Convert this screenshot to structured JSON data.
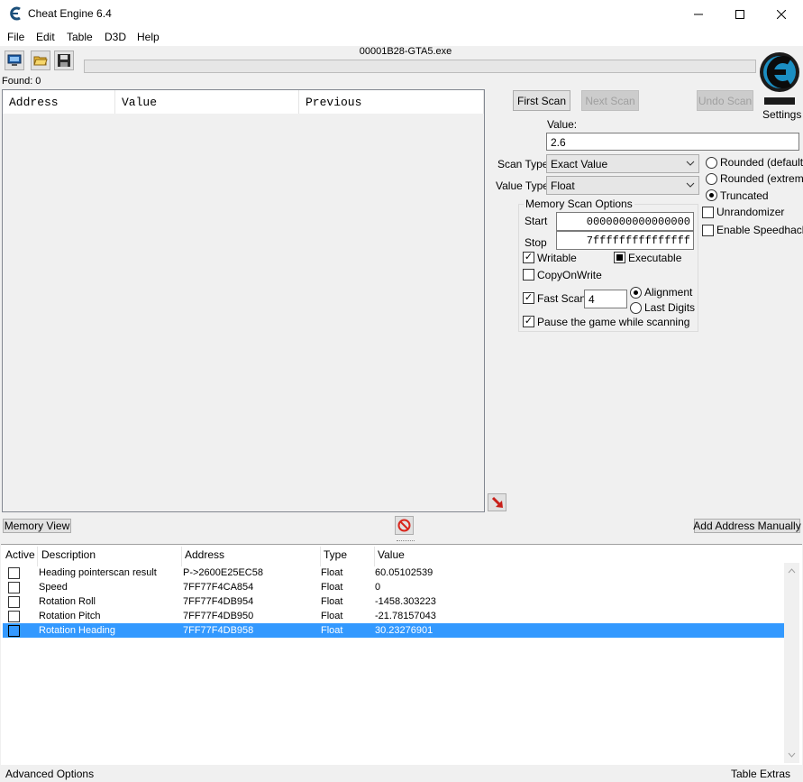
{
  "window": {
    "title": "Cheat Engine 6.4"
  },
  "menu": [
    "File",
    "Edit",
    "Table",
    "D3D",
    "Help"
  ],
  "process": "00001B28-GTA5.exe",
  "found": "Found: 0",
  "results": {
    "columns": [
      "Address",
      "Value",
      "Previous"
    ]
  },
  "buttons": {
    "first_scan": "First Scan",
    "next_scan": "Next Scan",
    "undo_scan": "Undo Scan",
    "memory_view": "Memory View",
    "add_address": "Add Address Manually"
  },
  "settings_label": "Settings",
  "scan": {
    "value_label": "Value:",
    "value": "2.6",
    "scan_type_label": "Scan Type",
    "scan_type": "Exact Value",
    "value_type_label": "Value Type",
    "value_type": "Float"
  },
  "rounding": {
    "rounded_default": "Rounded (default)",
    "rounded_extreme": "Rounded (extreme)",
    "truncated": "Truncated",
    "selected": "truncated"
  },
  "options": {
    "unrandomizer": "Unrandomizer",
    "speedhack": "Enable Speedhack"
  },
  "memory_scan": {
    "title": "Memory Scan Options",
    "start_label": "Start",
    "start": "0000000000000000",
    "stop_label": "Stop",
    "stop": "7fffffffffffffff",
    "writable": "Writable",
    "executable": "Executable",
    "copyonwrite": "CopyOnWrite",
    "fast_scan": "Fast Scan",
    "fast_scan_value": "4",
    "alignment": "Alignment",
    "last_digits": "Last Digits",
    "pause": "Pause the game while scanning"
  },
  "address_table": {
    "columns": [
      "Active",
      "Description",
      "Address",
      "Type",
      "Value"
    ],
    "rows": [
      {
        "description": "Heading pointerscan result",
        "address": "P->2600E25EC58",
        "type": "Float",
        "value": "60.05102539",
        "selected": false
      },
      {
        "description": "Speed",
        "address": "7FF77F4CA854",
        "type": "Float",
        "value": "0",
        "selected": false
      },
      {
        "description": "Rotation Roll",
        "address": "7FF77F4DB954",
        "type": "Float",
        "value": "-1458.303223",
        "selected": false
      },
      {
        "description": "Rotation Pitch",
        "address": "7FF77F4DB950",
        "type": "Float",
        "value": "-21.78157043",
        "selected": false
      },
      {
        "description": "Rotation Heading",
        "address": "7FF77F4DB958",
        "type": "Float",
        "value": "30.23276901",
        "selected": true
      }
    ]
  },
  "status": {
    "left": "Advanced Options",
    "right": "Table Extras"
  },
  "colors": {
    "selection": "#3399ff",
    "stop_icon": "#d9261c",
    "logo": "#1b8ec2"
  },
  "icons": [
    "cheat-engine-icon",
    "computer-process-icon",
    "open-folder-icon",
    "save-disk-icon",
    "stop-icon",
    "arrow-down-icon"
  ]
}
